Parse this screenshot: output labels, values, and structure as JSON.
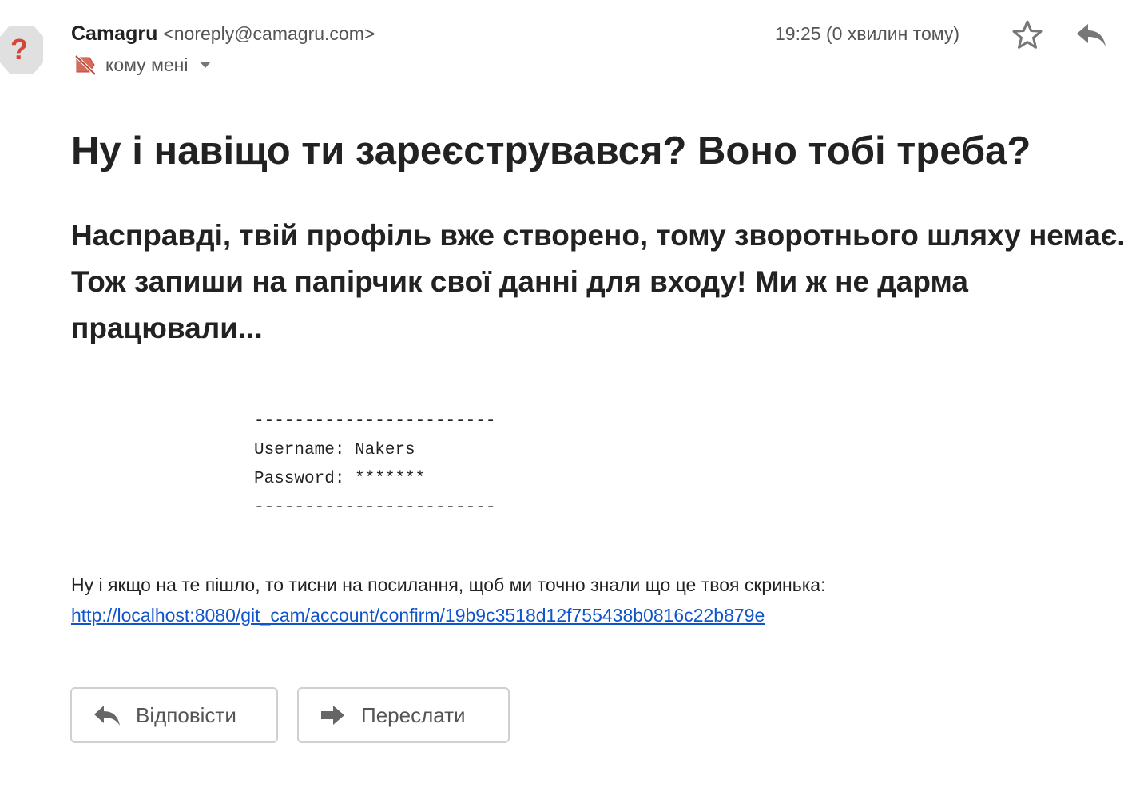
{
  "sender": {
    "name": "Camagru",
    "email": "<noreply@camagru.com>",
    "avatar_icon": "unknown-sender-question-icon",
    "avatar_color": "#e0e0e0",
    "avatar_mark_color": "#d44638"
  },
  "recipient": {
    "label": "кому мені",
    "icon": "not-important-marker-icon"
  },
  "time": "19:25 (0 хвилин тому)",
  "toolbar": {
    "star_icon": "star-icon",
    "reply_icon": "reply-icon"
  },
  "message": {
    "heading": "Ну і навіщо ти зареєструвався? Воно тобі треба?",
    "subheading": "Насправді, твій профіль вже створено, тому зворотнього шляху немає. Тож запиши на папірчик свої данні для входу! Ми ж не дарма працювали...",
    "credentials": {
      "divider": "------------------------",
      "username_label": "Username:",
      "username": "Nakers",
      "password_label": "Password:",
      "password": "*******"
    },
    "confirm_text": "Ну і якщо на те пішло, то тисни на посилання, щоб ми точно знали що це твоя скринька:",
    "confirm_link": "http://localhost:8080/git_cam/account/confirm/19b9c3518d12f755438b0816c22b879e"
  },
  "actions": {
    "reply_label": "Відповісти",
    "forward_label": "Переслати"
  },
  "colors": {
    "link": "#1155cc",
    "text": "#222222",
    "muted": "#555555",
    "button_border": "#d0d0d0"
  }
}
